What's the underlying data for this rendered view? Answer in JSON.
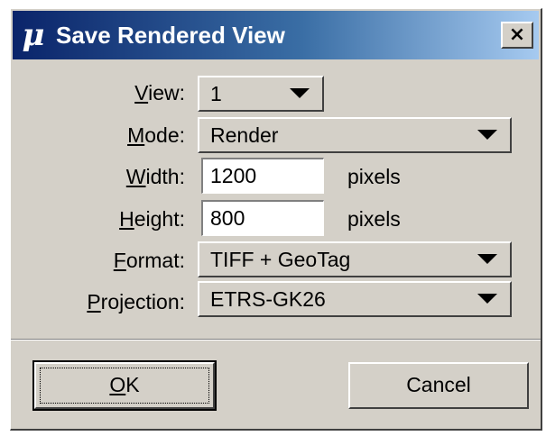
{
  "dialog": {
    "title": "Save Rendered View",
    "app_icon": "mu-icon",
    "app_icon_glyph": "μ",
    "close_label": "×"
  },
  "fields": {
    "view": {
      "label_ul": "V",
      "label_rest": "iew:",
      "value": "1"
    },
    "mode": {
      "label_ul": "M",
      "label_rest": "ode:",
      "value": "Render"
    },
    "width": {
      "label_ul": "W",
      "label_rest": "idth:",
      "value": "1200",
      "unit": "pixels"
    },
    "height": {
      "label_ul": "H",
      "label_rest": "eight:",
      "value": "800",
      "unit": "pixels"
    },
    "format": {
      "label_ul": "F",
      "label_rest": "ormat:",
      "value": "TIFF + GeoTag"
    },
    "projection": {
      "label_ul": "P",
      "label_rest": "rojection:",
      "value": "ETRS-GK26"
    }
  },
  "buttons": {
    "ok_ul": "O",
    "ok_rest": "K",
    "cancel": "Cancel"
  },
  "colors": {
    "dialog_bg": "#d4d0c8",
    "title_start": "#0a246a",
    "title_end": "#a6caf0"
  }
}
